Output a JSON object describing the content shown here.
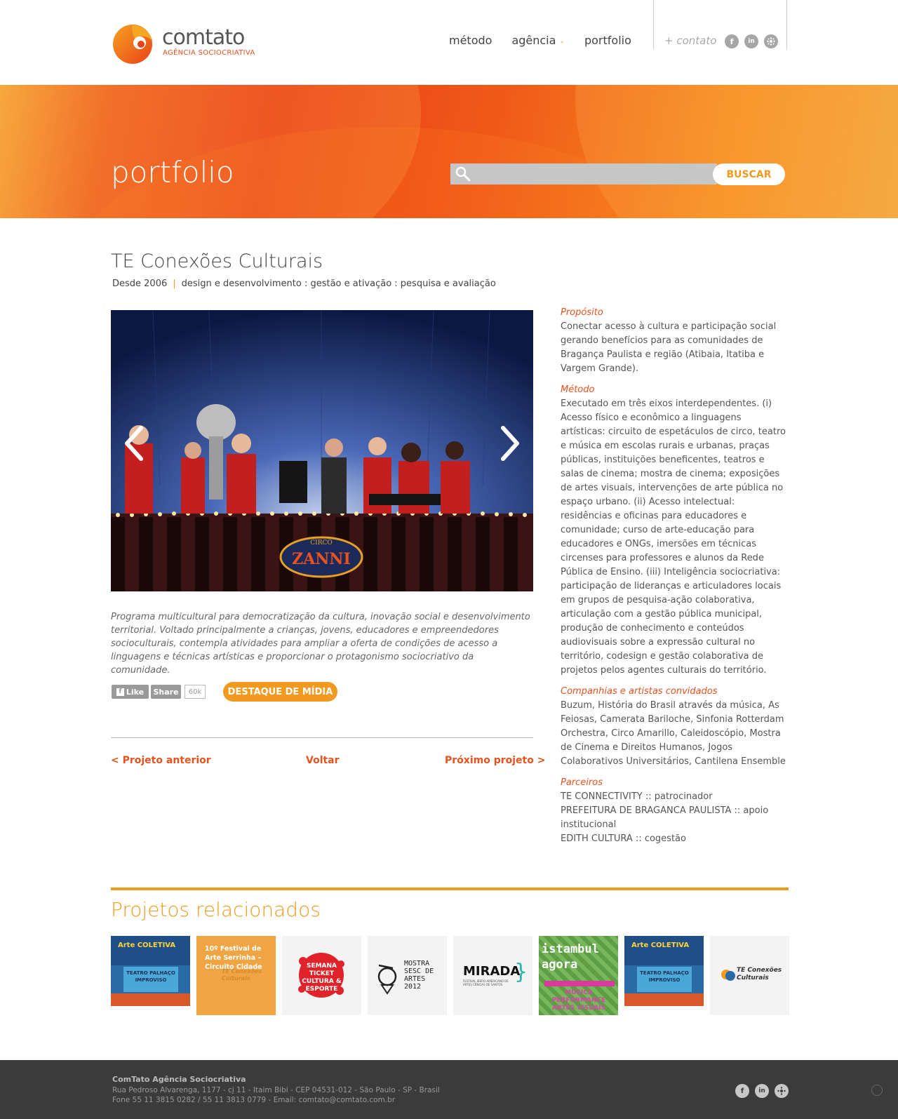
{
  "header": {
    "logo_word": "comtato",
    "logo_sub": "AGÊNCIA SOCIOCRIATIVA",
    "nav": [
      {
        "label": "método"
      },
      {
        "label": "agência"
      },
      {
        "label": "portfolio"
      }
    ],
    "contato": "+ contato",
    "social": [
      "facebook-icon",
      "linkedin-icon",
      "network-icon"
    ]
  },
  "banner": {
    "title": "portfolio",
    "search_placeholder": "",
    "search_button": "BUSCAR"
  },
  "project": {
    "title": "TE Conexões Culturais",
    "since": "Desde 2006",
    "sep": "|",
    "categories": "design e desenvolvimento : gestão e ativação : pesquisa e avaliação",
    "caption": "Programa multicultural para democratização da cultura, inovação social e desenvolvimento territorial. Voltado principalmente a crianças, jovens, educadores e empreendedores socioculturais, contempla atividades para ampliar a oferta de condições de acesso a linguagens e técnicas artísticas e proporcionar o protagonismo sociocriativo da comunidade.",
    "like": "Like",
    "share": "Share",
    "share_count": "60k",
    "destaque": "DESTAQUE DE MÍDIA",
    "prev": "< Projeto anterior",
    "back": "Voltar",
    "next": "Próximo projeto >",
    "slide_sign": "ZANNI",
    "slide_sign_top": "CIRCO"
  },
  "side": {
    "proposito_h": "Propósito",
    "proposito": "Conectar acesso à cultura e participação social gerando benefícios para as comunidades de Bragança Paulista e região (Atibaia, Itatiba e Vargem Grande).",
    "metodo_h": "Método",
    "metodo": "Executado em três eixos interdependentes. (i) Acesso físico e econômico a linguagens artísticas: circuito de espetáculos de circo, teatro e música em escolas rurais e urbanas, praças públicas, instituições beneficentes, teatros e salas de cinema; mostra de cinema; exposições de artes visuais, intervenções de arte pública no espaço urbano. (ii) Acesso intelectual: residências e oficinas para educadores e comunidade; curso de arte-educação para educadores e ONGs, imersões em técnicas circenses para professores e alunos da Rede Pública de Ensino. (iii) Inteligência sociocriativa: participação de lideranças e articuladores locais em grupos de pesquisa-ação colaborativa, articulação com a gestão pública municipal, produção de conhecimento e conteúdos audiovisuais sobre a expressão cultural no território, codesign e gestão colaborativa de projetos pelos agentes culturais do território.",
    "companhias_h": "Companhias e artistas convidados",
    "companhias": "Buzum, História do Brasil através da música, As Feiosas, Camerata Bariloche, Sinfonia Rotterdam Orchestra, Circo Amarillo, Caleidoscópio, Mostra de Cinema e Direitos Humanos, Jogos Colaborativos Universitários, Cantilena Ensemble",
    "parceiros_h": "Parceiros",
    "parceiros": [
      "TE CONNECTIVITY :: patrocinador",
      "PREFEITURA DE BRAGANCA PAULISTA :: apoio institucional",
      "EDITH CULTURA :: cogestão"
    ]
  },
  "related": {
    "title": "Projetos relacionados",
    "items": [
      {
        "name": "arte-coletiva",
        "label": "TEATRO PALHAÇO IMPROVISO",
        "top": "Arte COLETIVA"
      },
      {
        "name": "festival-arte-serrinha",
        "label": "10º Festival de Arte Serrinha – Circuito Cidade",
        "sub": "TE Conexões Culturais"
      },
      {
        "name": "semana-ticket",
        "label": "SEMANA TICKET CULTURA & ESPORTE"
      },
      {
        "name": "mostra-sesc",
        "label": "MOSTRA SESC DE ARTES 2012"
      },
      {
        "name": "mirada",
        "label": "MIRADA",
        "sub": "FESTIVAL IBERO-AMERICANO DE ARTES CÊNICAS DE SANTOS"
      },
      {
        "name": "istambul-agora",
        "label": "istambul agora",
        "sub": "MÚSICA PERFORMANCE ARTES VISUAIS"
      },
      {
        "name": "arte-coletiva-2",
        "label": "TEATRO PALHAÇO IMPROVISO",
        "top": "Arte COLETIVA"
      },
      {
        "name": "te-conexoes",
        "label": "TE Conexões Culturais"
      }
    ]
  },
  "footer": {
    "name": "ComTato Agência Sociocriativa",
    "address": "Rua Pedroso Alvarenga, 1177 - cj 11 - Itaim Bibi - CEP 04531-012 - São Paulo - SP - Brasil",
    "contact": "Fone 55 11 3815 0282 / 55 11 3813 0779  -  Email: comtato@comtato.com.br"
  },
  "colors": {
    "accent": "#f19a1f",
    "brand_red": "#e8521f",
    "footer_bg": "#3b3b3b"
  }
}
